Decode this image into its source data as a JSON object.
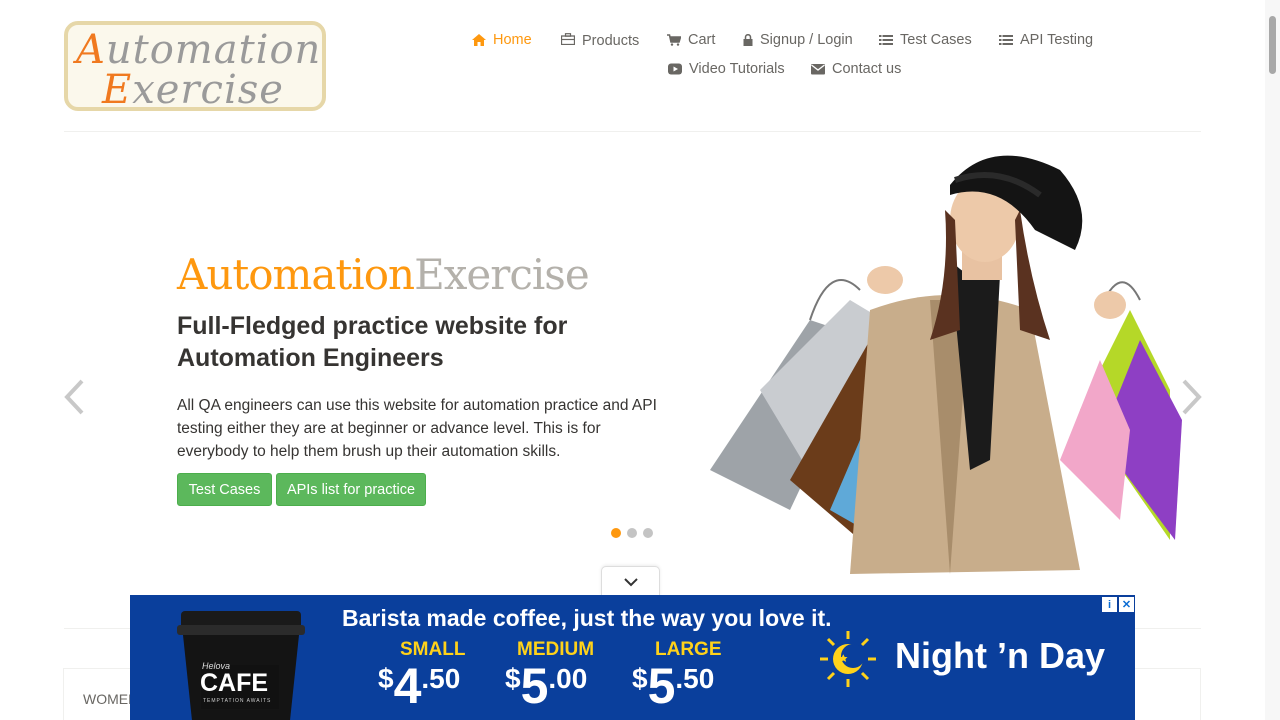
{
  "logo": {
    "line1_first": "A",
    "line1_rest": "utomation",
    "line2_first": "E",
    "line2_rest": "xercise"
  },
  "nav": {
    "home": "Home",
    "products": "Products",
    "cart": "Cart",
    "login": "Signup / Login",
    "test_cases": "Test Cases",
    "api_testing": "API Testing",
    "video_tutorials": "Video Tutorials",
    "contact": "Contact us"
  },
  "slider": {
    "brand_a": "Automation",
    "brand_b": "Exercise",
    "headline": "Full-Fledged practice website for Automation Engineers",
    "description": "All QA engineers can use this website for automation practice and API testing either they are at beginner or advance level. This is for everybody to help them brush up their automation skills.",
    "btn_test_cases": "Test Cases",
    "btn_apis": "APIs list for practice",
    "active_slide": 1,
    "slide_count": 3
  },
  "category": {
    "label": "WOMEN"
  },
  "ad": {
    "cup_brand": "Helova",
    "cup_name": "CAFE",
    "cup_tag": "TEMPTATION AWAITS",
    "tagline": "Barista made coffee, just the way you love it.",
    "sizes": [
      {
        "name": "SMALL",
        "currency": "$",
        "dollars": "4",
        "cents": ".50"
      },
      {
        "name": "MEDIUM",
        "currency": "$",
        "dollars": "5",
        "cents": ".00"
      },
      {
        "name": "LARGE",
        "currency": "$",
        "dollars": "5",
        "cents": ".50"
      }
    ],
    "brand": "Night ’n Day"
  },
  "colors": {
    "accent": "#fe980f",
    "button": "#5cb85c",
    "ad_bg": "#0a3f9c",
    "ad_yellow": "#ffd21a"
  }
}
